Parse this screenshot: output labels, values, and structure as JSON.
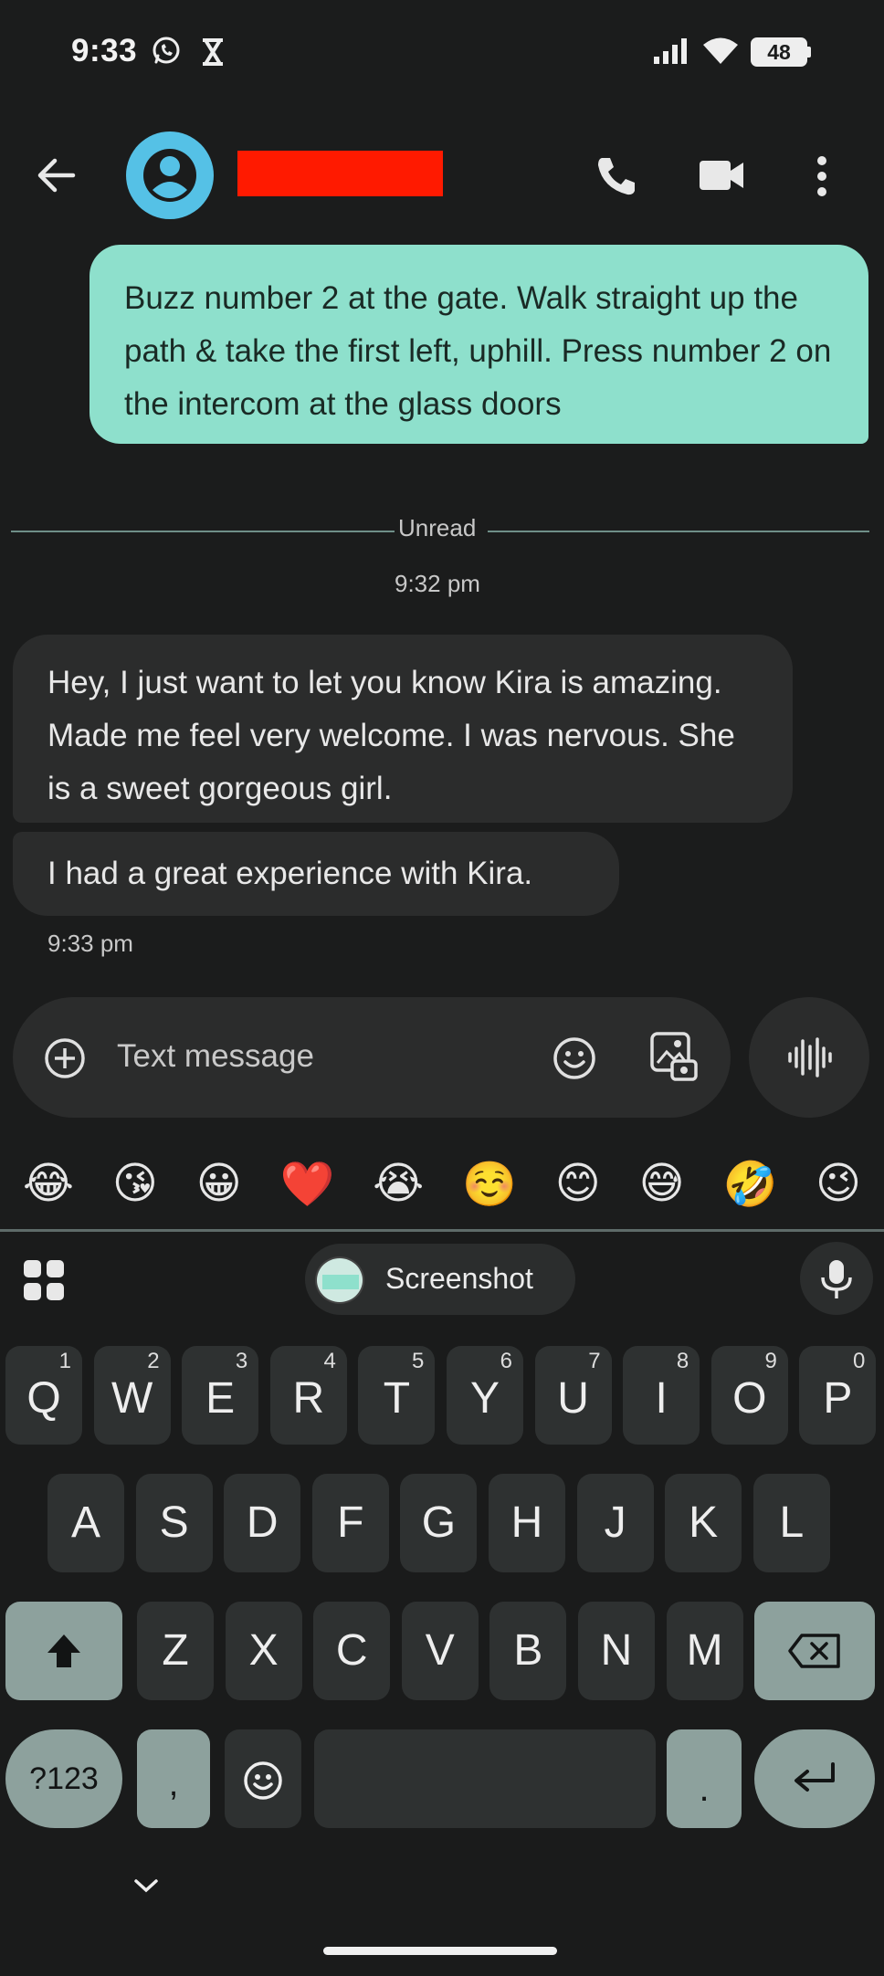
{
  "status_bar": {
    "time": "9:33",
    "battery": "48"
  },
  "header": {
    "contact_name_redacted": true
  },
  "messages": {
    "outgoing": "Buzz number 2 at the gate. Walk straight up the path & take the first left, uphill. Press number 2 on the intercom at the glass doors",
    "unread_label": "Unread",
    "time_1": "9:32 pm",
    "incoming_1": "Hey, I just want to let you know Kira  is amazing. Made me feel very welcome. I was nervous. She is a sweet gorgeous girl.",
    "incoming_2": "I had a great experience with Kira.",
    "time_2": "9:33 pm"
  },
  "compose": {
    "placeholder": "Text message"
  },
  "emoji_suggestions": [
    "😂",
    "😘",
    "😀",
    "❤️",
    "😭",
    "☺️",
    "😊",
    "😅",
    "🤣",
    "😉"
  ],
  "keyboard": {
    "suggestion_chip": "Screenshot",
    "row1": [
      {
        "k": "Q",
        "h": "1"
      },
      {
        "k": "W",
        "h": "2"
      },
      {
        "k": "E",
        "h": "3"
      },
      {
        "k": "R",
        "h": "4"
      },
      {
        "k": "T",
        "h": "5"
      },
      {
        "k": "Y",
        "h": "6"
      },
      {
        "k": "U",
        "h": "7"
      },
      {
        "k": "I",
        "h": "8"
      },
      {
        "k": "O",
        "h": "9"
      },
      {
        "k": "P",
        "h": "0"
      }
    ],
    "row2": [
      "A",
      "S",
      "D",
      "F",
      "G",
      "H",
      "J",
      "K",
      "L"
    ],
    "row3": [
      "Z",
      "X",
      "C",
      "V",
      "B",
      "N",
      "M"
    ],
    "symbols_key": "?123",
    "comma_key": ",",
    "period_key": "."
  },
  "colors": {
    "outgoing_bubble": "#8ee0cc",
    "incoming_bubble": "#2b2c2c",
    "avatar": "#55c1e6",
    "redaction": "#ff1a00",
    "special_key": "#8da19d"
  }
}
